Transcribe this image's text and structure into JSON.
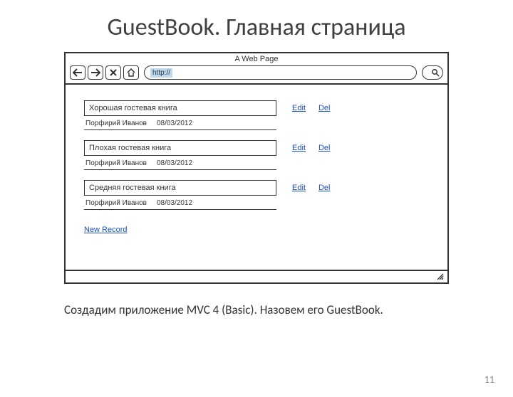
{
  "slide": {
    "title": "GuestBook. Главная страница",
    "caption": "Создадим приложение MVC 4 (Basic).   Назовем его GuestBook.",
    "page_number": "11"
  },
  "browser": {
    "window_title": "A Web Page",
    "url_value": "http://",
    "icons": {
      "back": "back-arrow-icon",
      "forward": "forward-arrow-icon",
      "stop": "stop-x-icon",
      "home": "home-icon",
      "search": "magnifier-icon",
      "resize": "resize-grip-icon"
    }
  },
  "entries": [
    {
      "title": "Хорошая гостевая книга",
      "author": "Порфирий Иванов",
      "date": "08/03/2012",
      "edit": "Edit",
      "del": "Del"
    },
    {
      "title": "Плохая гостевая книга",
      "author": "Порфирий Иванов",
      "date": "08/03/2012",
      "edit": "Edit",
      "del": "Del"
    },
    {
      "title": "Средняя гостевая книга",
      "author": "Порфирий Иванов",
      "date": "08/03/2012",
      "edit": "Edit",
      "del": "Del"
    }
  ],
  "actions": {
    "new_record": "New Record"
  }
}
